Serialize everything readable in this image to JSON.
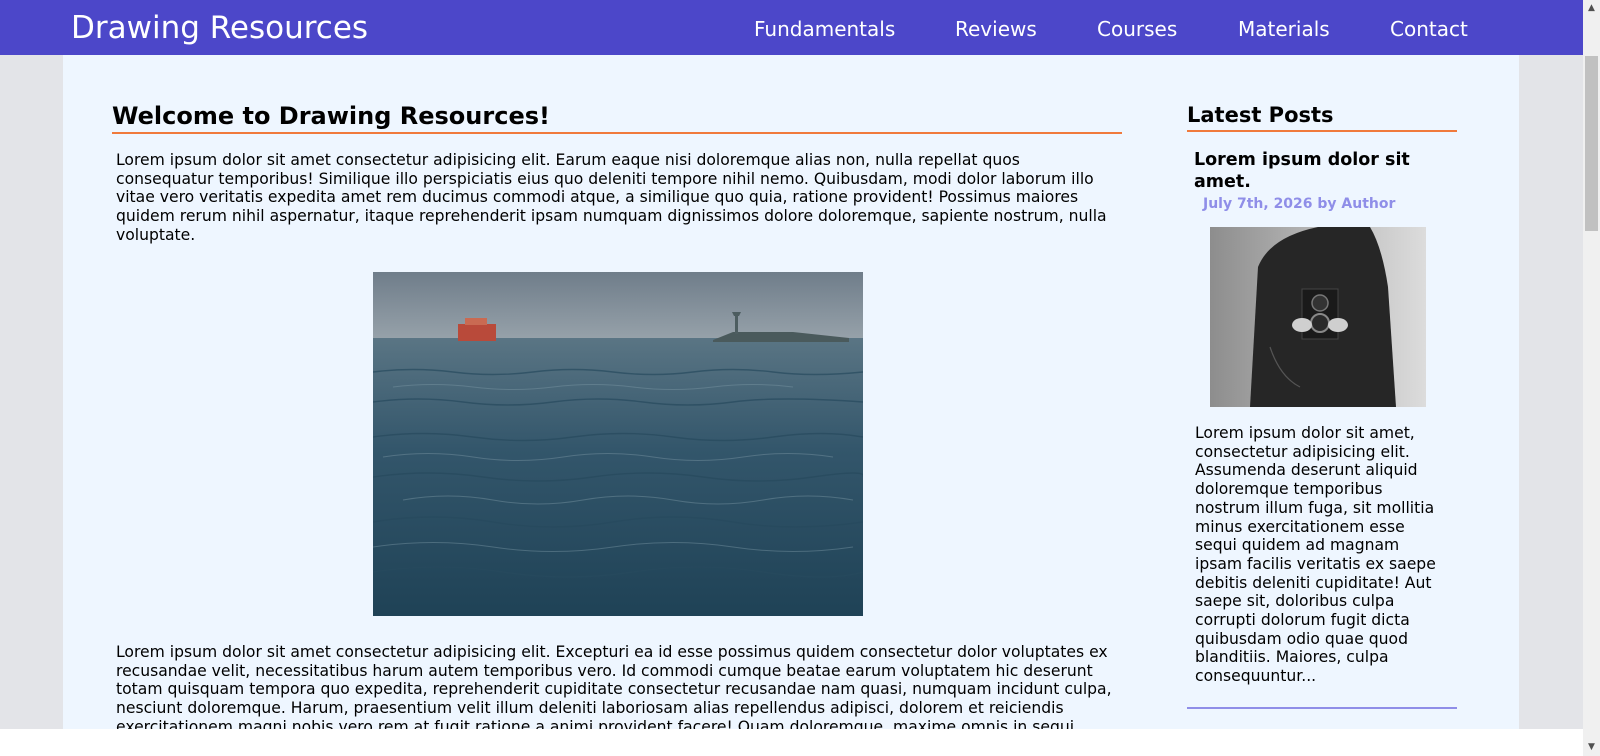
{
  "header": {
    "brand": "Drawing Resources",
    "nav": [
      "Fundamentals",
      "Reviews",
      "Courses",
      "Materials",
      "Contact"
    ]
  },
  "main": {
    "title": "Welcome to Drawing Resources!",
    "paragraph1": "Lorem ipsum dolor sit amet consectetur adipisicing elit. Earum eaque nisi doloremque alias non, nulla repellat quos consequatur temporibus! Similique illo perspiciatis eius quo deleniti tempore nihil nemo. Quibusdam, modi dolor laborum illo vitae vero veritatis expedita amet rem ducimus commodi atque, a similique quo quia, ratione provident! Possimus maiores quidem rerum nihil aspernatur, itaque reprehenderit ipsam numquam dignissimos dolore doloremque, sapiente nostrum, nulla voluptate.",
    "paragraph2": "Lorem ipsum dolor sit amet consectetur adipisicing elit. Excepturi ea id esse possimus quidem consectetur dolor voluptates ex recusandae velit, necessitatibus harum autem temporibus vero. Id commodi cumque beatae earum voluptatem hic deserunt totam quisquam tempora quo expedita, reprehenderit cupiditate consectetur recusandae nam quasi, numquam incidunt culpa, nesciunt doloremque. Harum, praesentium velit illum deleniti laboriosam alias repellendus adipisci, dolorem et reiciendis exercitationem magni nobis vero rem at fugit ratione a animi provident facere! Quam doloremque, maxime omnis in sequi"
  },
  "sidebar": {
    "title": "Latest Posts",
    "post": {
      "title": "Lorem ipsum dolor sit amet.",
      "meta": "July 7th, 2026 by Author",
      "excerpt": "Lorem ipsum dolor sit amet, consectetur adipisicing elit. Assumenda deserunt aliquid doloremque temporibus nostrum illum fuga, sit mollitia minus exercitationem esse sequi quidem ad magnam ipsam facilis veritatis ex saepe debitis deleniti cupiditate! Aut saepe sit, doloribus culpa corrupti dolorum fugit dicta quibusdam odio quae quod blanditiis. Maiores, culpa consequuntur..."
    }
  },
  "colors": {
    "nav_background": "#4c47c9",
    "page_background": "#eef6ff",
    "accent_orange": "#f07a3c",
    "meta_purple": "#8f8ee8"
  }
}
